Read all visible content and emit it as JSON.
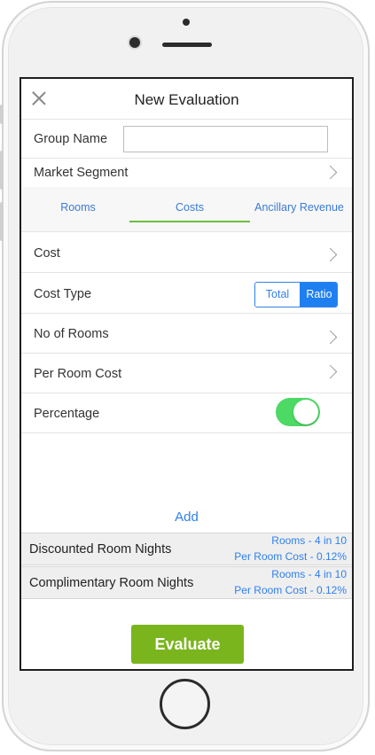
{
  "header": {
    "title": "New Evaluation"
  },
  "form": {
    "group_name_label": "Group Name",
    "group_name_value": "",
    "market_segment_label": "Market Segment"
  },
  "tabs": [
    {
      "label": "Rooms",
      "active": false
    },
    {
      "label": "Costs",
      "active": true
    },
    {
      "label": "Ancillary Revenue",
      "active": false
    }
  ],
  "costs": {
    "cost_label": "Cost",
    "cost_type_label": "Cost Type",
    "cost_type_options": [
      "Total",
      "Ratio"
    ],
    "cost_type_selected": "Ratio",
    "no_of_rooms_label": "No of Rooms",
    "per_room_cost_label": "Per Room Cost",
    "percentage_label": "Percentage",
    "percentage_on": true
  },
  "add_label": "Add",
  "summary": [
    {
      "label": "Discounted Room Nights",
      "line1": "Rooms - 4 in 10",
      "line2": "Per Room Cost - 0.12%"
    },
    {
      "label": "Complimentary Room Nights",
      "line1": "Rooms - 4 in 10",
      "line2": "Per Room Cost - 0.12%"
    }
  ],
  "evaluate_label": "Evaluate",
  "colors": {
    "accent_blue": "#2f80ed",
    "accent_green": "#7ab51d",
    "switch_green": "#4cd964"
  }
}
